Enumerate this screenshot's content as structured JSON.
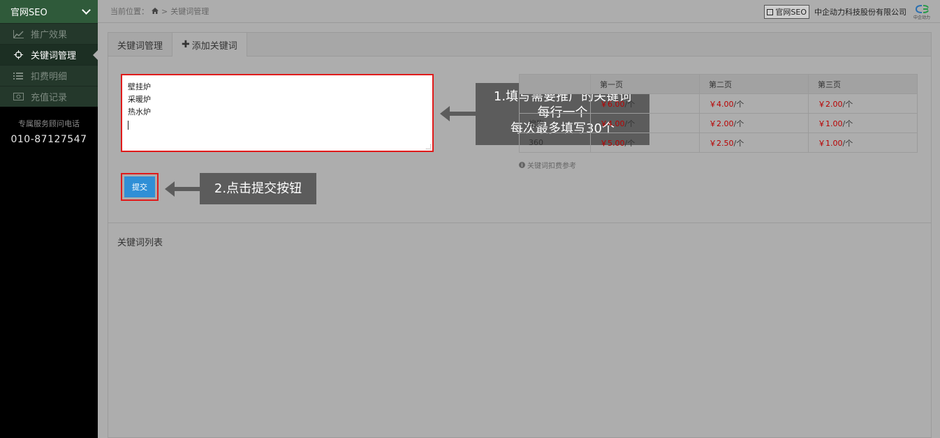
{
  "sidebar": {
    "brand": "官网SEO",
    "items": [
      {
        "label": "推广效果",
        "icon": "line-chart-icon"
      },
      {
        "label": "关键词管理",
        "icon": "crosshair-icon"
      },
      {
        "label": "扣费明细",
        "icon": "list-icon"
      },
      {
        "label": "充值记录",
        "icon": "money-icon"
      }
    ],
    "active_index": 1,
    "service_label": "专属服务顾问电话",
    "service_phone": "010-87127547"
  },
  "topbar": {
    "breadcrumb_prefix": "当前位置：",
    "breadcrumb_sep": ">",
    "breadcrumb_current": "关键词管理",
    "badge": "官网SEO",
    "company": "中企动力科技股份有限公司",
    "logo_text": "中企动力"
  },
  "tabs": [
    {
      "label": "关键词管理"
    },
    {
      "label": "添加关键词"
    }
  ],
  "form": {
    "keywords": [
      "壁挂炉",
      "采暖炉",
      "热水炉"
    ],
    "submit_label": "提交"
  },
  "price_table": {
    "headers": [
      "",
      "第一页",
      "第二页",
      "第三页"
    ],
    "rows": [
      [
        "",
        "￥6.00/个",
        "￥4.00/个",
        "￥2.00/个"
      ],
      [
        "搜狗",
        "￥4.00/个",
        "￥2.00/个",
        "￥1.00/个"
      ],
      [
        "360",
        "￥5.00/个",
        "￥2.50/个",
        "￥1.00/个"
      ]
    ],
    "note": "关键词扣费参考"
  },
  "callouts": {
    "step1_lines": [
      "1.填写需要推广的关键词",
      "每行一个",
      "每次最多填写30个"
    ],
    "step2": "2.点击提交按钮"
  },
  "list": {
    "title": "关键词列表"
  },
  "colors": {
    "sidebar_brand": "#2f5a3a",
    "highlight": "#e01a1a",
    "button": "#2f8fd6",
    "price": "#b80000"
  }
}
